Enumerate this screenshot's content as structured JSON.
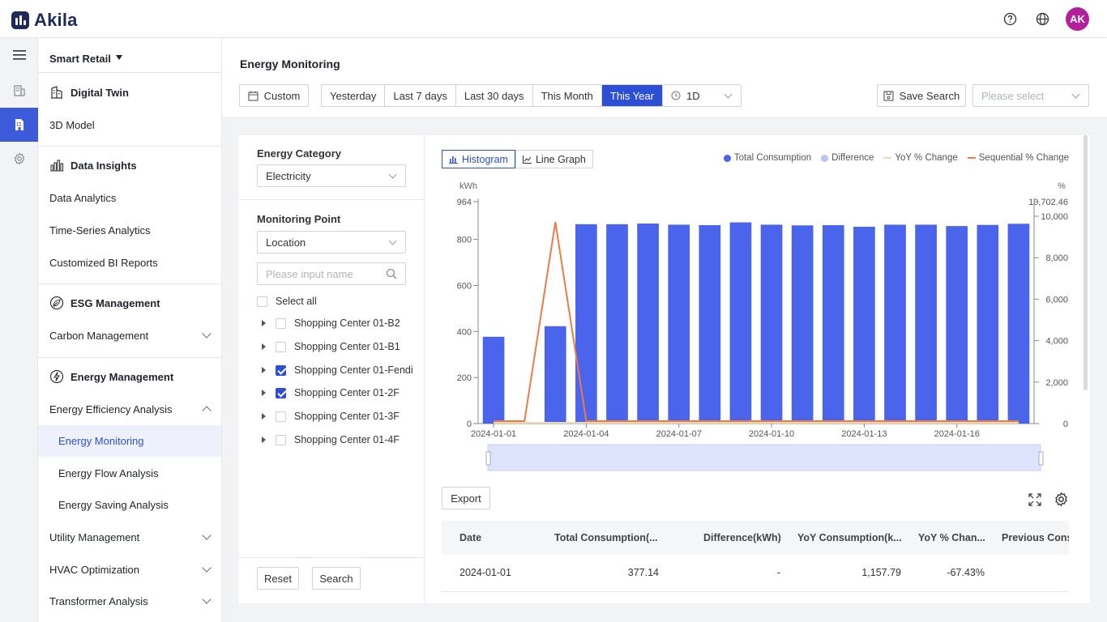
{
  "app": {
    "name": "Akila",
    "avatar": "AK"
  },
  "sidebar": {
    "workspace": "Smart Retail",
    "sections": [
      {
        "title": "Digital Twin",
        "items": [
          "3D Model"
        ]
      },
      {
        "title": "Data Insights",
        "items": [
          "Data Analytics",
          "Time-Series Analytics",
          "Customized BI Reports"
        ]
      },
      {
        "title": "ESG Management",
        "items": [
          "Carbon Management"
        ]
      },
      {
        "title": "Energy Management",
        "items": [
          "Energy Efficiency Analysis",
          "Energy Monitoring",
          "Energy Flow Analysis",
          "Energy Saving Analysis",
          "Utility Management",
          "HVAC Optimization",
          "Transformer Analysis"
        ]
      }
    ]
  },
  "page": {
    "title": "Energy Monitoring"
  },
  "toolbar": {
    "custom": "Custom",
    "ranges": [
      "Yesterday",
      "Last 7 days",
      "Last 30 days",
      "This Month",
      "This Year"
    ],
    "active_range": "This Year",
    "granularity": "1D",
    "save_search": "Save Search",
    "saved_placeholder": "Please select"
  },
  "filters": {
    "energy_category_label": "Energy Category",
    "energy_category": "Electricity",
    "monitoring_point_label": "Monitoring Point",
    "monitoring_point": "Location",
    "search_placeholder": "Please input name",
    "select_all": "Select all",
    "points": [
      {
        "name": "Shopping Center 01-B2",
        "checked": false
      },
      {
        "name": "Shopping Center 01-B1",
        "checked": false
      },
      {
        "name": "Shopping Center 01-Fendi",
        "checked": true
      },
      {
        "name": "Shopping Center 01-2F",
        "checked": true
      },
      {
        "name": "Shopping Center 01-3F",
        "checked": false
      },
      {
        "name": "Shopping Center 01-4F",
        "checked": false
      }
    ],
    "reset": "Reset",
    "search": "Search"
  },
  "chart_view": {
    "histogram": "Histogram",
    "line_graph": "Line Graph",
    "active": "Histogram"
  },
  "chart_data": {
    "type": "bar",
    "left_unit": "kWh",
    "right_unit": "%",
    "left_ticks": [
      "964",
      "800",
      "600",
      "400",
      "200",
      "0"
    ],
    "right_ticks": [
      "10,702.46",
      "10,000",
      "8,000",
      "6,000",
      "4,000",
      "2,000",
      "0"
    ],
    "ylim_left": [
      0,
      964
    ],
    "ylim_right": [
      0,
      10702.46
    ],
    "x": [
      "2024-01-01",
      "2024-01-02",
      "2024-01-03",
      "2024-01-04",
      "2024-01-05",
      "2024-01-06",
      "2024-01-07",
      "2024-01-08",
      "2024-01-09",
      "2024-01-10",
      "2024-01-11",
      "2024-01-12",
      "2024-01-13",
      "2024-01-14",
      "2024-01-15",
      "2024-01-16",
      "2024-01-17",
      "2024-01-18"
    ],
    "x_tick_labels": [
      "2024-01-01",
      "2024-01-04",
      "2024-01-07",
      "2024-01-10",
      "2024-01-13",
      "2024-01-16"
    ],
    "series": [
      {
        "name": "Total Consumption",
        "color": "#4a64ec",
        "values": [
          377.14,
          null,
          423,
          866,
          866,
          869,
          864,
          862,
          874,
          864,
          861,
          862,
          855,
          864,
          864,
          858,
          863,
          868
        ]
      },
      {
        "name": "Difference",
        "color": "#b8c4f5",
        "values": []
      },
      {
        "name": "YoY % Change",
        "color": "#f5d9a8",
        "values": [
          -67.43,
          -67,
          -67,
          -20,
          -20,
          -20,
          -20,
          -20,
          -20,
          -20,
          -20,
          -20,
          -20,
          -20,
          -20,
          -20,
          -20,
          -20
        ]
      },
      {
        "name": "Sequential % Change",
        "color": "#f07a45",
        "values": [
          0,
          0,
          9600,
          0,
          0,
          0,
          0,
          0,
          0,
          0,
          0,
          0,
          0,
          0,
          0,
          0,
          0,
          0
        ]
      }
    ]
  },
  "table": {
    "export": "Export",
    "headers": [
      "Date",
      "Total Consumption(...",
      "Difference(kWh)",
      "YoY Consumption(k...",
      "YoY % Chan...",
      "Previous Consu"
    ],
    "rows": [
      [
        "2024-01-01",
        "377.14",
        "-",
        "1,157.79",
        "-67.43%",
        ""
      ]
    ]
  }
}
